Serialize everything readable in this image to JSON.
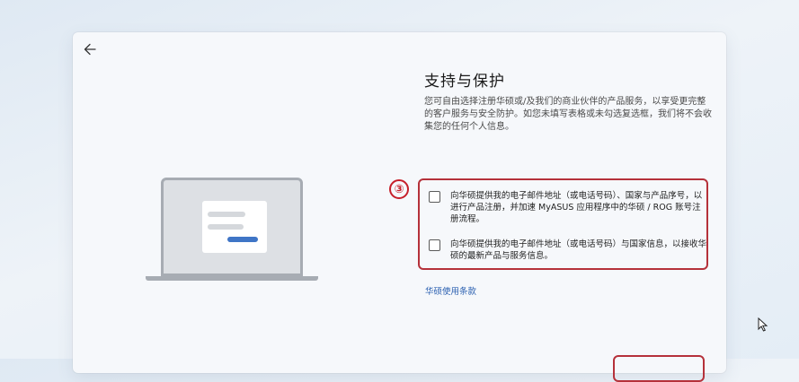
{
  "header": {
    "back_icon": "arrow-left-icon",
    "title": "支持与保护"
  },
  "description": "您可自由选择注册华硕或/及我们的商业伙伴的产品服务，以享受更完整的客户服务与安全防护。如您未填写表格或未勾选复选框，我们将不会收集您的任何个人信息。",
  "annotation": {
    "step_marker": "③",
    "highlight_color": "#b5313a"
  },
  "options": [
    {
      "label": "向华硕提供我的电子邮件地址（或电话号码）、国家与产品序号，以进行产品注册，并加速 MyASUS 应用程序中的华硕 / ROG 账号注册流程。",
      "checked": false
    },
    {
      "label": "向华硕提供我的电子邮件地址（或电话号码）与国家信息，以接收华硕的最新产品与服务信息。",
      "checked": false
    }
  ],
  "links": {
    "terms": "华硕使用条款"
  },
  "colors": {
    "accent": "#3f75c6",
    "link": "#2a5fb0"
  }
}
